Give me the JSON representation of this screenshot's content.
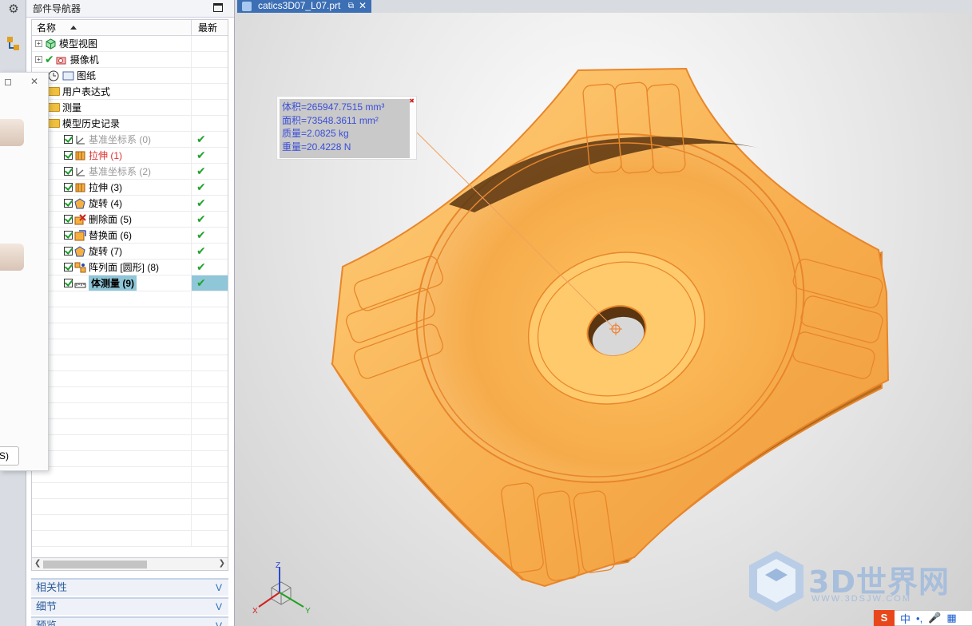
{
  "navigator": {
    "title": "部件导航器",
    "col_name": "名称",
    "col_new": "最新",
    "items": [
      {
        "label": "模型视图",
        "style": "normal"
      },
      {
        "label": "摄像机",
        "style": "normal"
      },
      {
        "label": "图纸",
        "style": "normal"
      },
      {
        "label": "用户表达式",
        "style": "normal"
      },
      {
        "label": "测量",
        "style": "normal"
      },
      {
        "label": "模型历史记录",
        "style": "normal"
      },
      {
        "label": "基准坐标系 (0)",
        "style": "grey",
        "latest": "✔"
      },
      {
        "label": "拉伸 (1)",
        "style": "red",
        "latest": "✔"
      },
      {
        "label": "基准坐标系 (2)",
        "style": "grey",
        "latest": "✔"
      },
      {
        "label": "拉伸 (3)",
        "style": "normal",
        "latest": "✔"
      },
      {
        "label": "旋转 (4)",
        "style": "normal",
        "latest": "✔"
      },
      {
        "label": "删除面 (5)",
        "style": "normal",
        "latest": "✔"
      },
      {
        "label": "替换面 (6)",
        "style": "normal",
        "latest": "✔"
      },
      {
        "label": "旋转 (7)",
        "style": "normal",
        "latest": "✔"
      },
      {
        "label": "阵列面 [圆形] (8)",
        "style": "normal",
        "latest": "✔"
      },
      {
        "label": "体测量 (9)",
        "style": "selected",
        "latest": "✔"
      }
    ],
    "panels": [
      "相关性",
      "细节",
      "预览"
    ]
  },
  "floating_dialog": {
    "button_text": "S)"
  },
  "tab": {
    "title": "catics3D07_L07.prt",
    "close": "✕"
  },
  "measurement": {
    "volume": "体积=265947.7515 mm³",
    "area": "面积=73548.3611 mm²",
    "mass": "质量=2.0825 kg",
    "weight": "重量=20.4228 N"
  },
  "triad": {
    "x": "X",
    "y": "Y",
    "z": "Z"
  },
  "watermark": {
    "name": "3D世界网",
    "url": "WWW.3DSJW.COM"
  },
  "ime": {
    "logo": "S",
    "mode": "中"
  },
  "colors": {
    "part": "#f6a94a",
    "part_edge": "#e8862a",
    "tab": "#3c6fb4",
    "selection": "#8fc6d8"
  }
}
